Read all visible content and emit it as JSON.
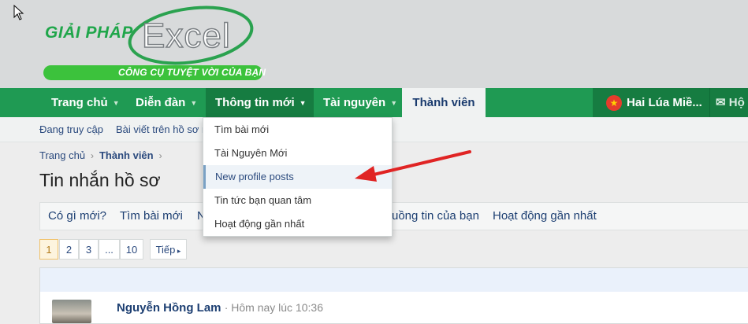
{
  "logo": {
    "giai_phap": "GIẢI PHÁP",
    "excel": "Excel",
    "tagline": "CÔNG CỤ TUYỆT VỜI CỦA BẠN"
  },
  "nav": {
    "items": [
      {
        "label": "Trang chủ"
      },
      {
        "label": "Diễn đàn"
      },
      {
        "label": "Thông tin mới"
      },
      {
        "label": "Tài nguyên"
      },
      {
        "label": "Thành viên"
      }
    ],
    "user": "Hai Lúa Miề...",
    "mail": "Hộ"
  },
  "subnav": {
    "items": [
      "Đang truy cập",
      "Bài viết trên hồ sơ m"
    ]
  },
  "breadcrumb": {
    "home": "Trang chủ",
    "current": "Thành viên"
  },
  "page_title": "Tin nhắn hồ sơ",
  "tabs": {
    "items": [
      "Có gì mới?",
      "Tìm bài mới",
      "N",
      "uồng tin của bạn",
      "Hoạt động gần nhất"
    ]
  },
  "pager": {
    "pages": [
      "1",
      "2",
      "3",
      "...",
      "10"
    ],
    "next": "Tiếp"
  },
  "post": {
    "author": "Nguyễn Hồng Lam",
    "time": "Hôm nay lúc 10:36"
  },
  "dropdown": {
    "items": [
      "Tìm bài mới",
      "Tài Nguyên Mới",
      "New profile posts",
      "Tin tức bạn quan tâm",
      "Hoạt động gần nhất"
    ]
  },
  "colors": {
    "nav_green": "#1f9a53",
    "accent_red": "#e02424",
    "link_blue": "#2b4a7e"
  }
}
